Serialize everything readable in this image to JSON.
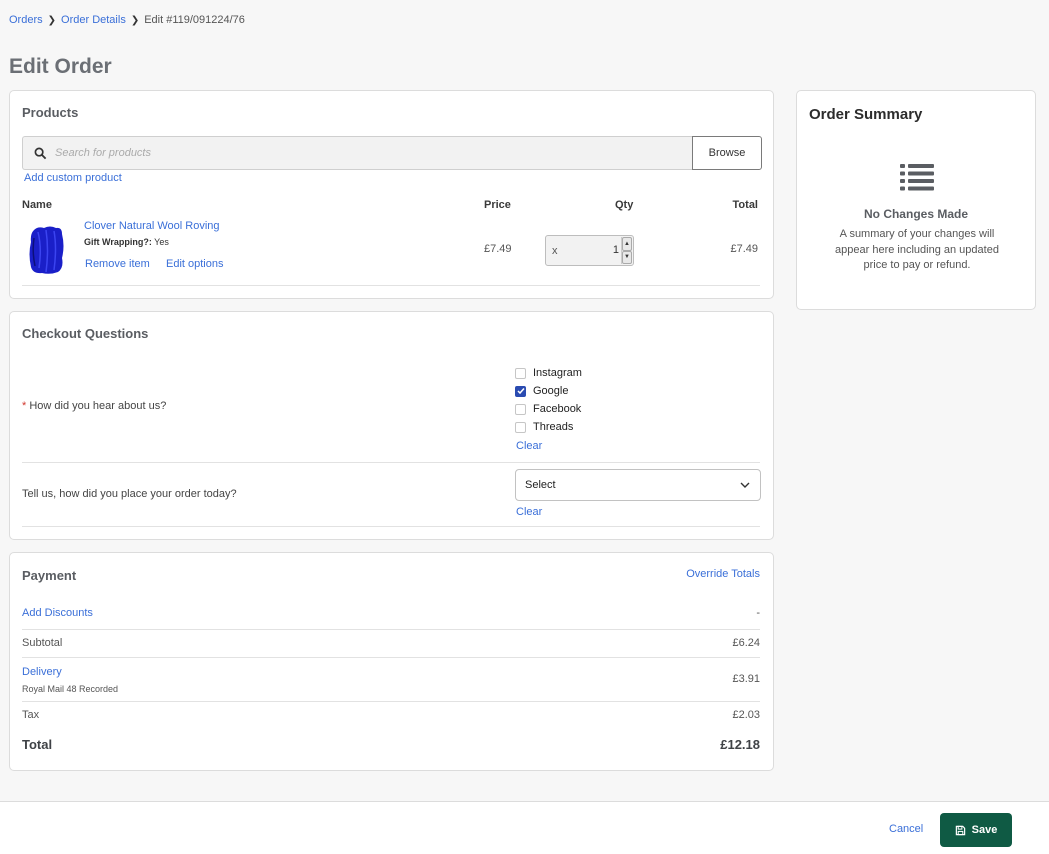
{
  "breadcrumb": {
    "orders": "Orders",
    "order_details": "Order Details",
    "current": "Edit #119/091224/76"
  },
  "page_title": "Edit Order",
  "products": {
    "title": "Products",
    "search_placeholder": "Search for products",
    "browse_label": "Browse",
    "add_custom_label": "Add custom product",
    "columns": {
      "name": "Name",
      "price": "Price",
      "qty": "Qty",
      "total": "Total"
    },
    "items": [
      {
        "name": "Clover Natural Wool Roving",
        "option_label": "Gift Wrapping?:",
        "option_value": "Yes",
        "remove_label": "Remove item",
        "edit_label": "Edit options",
        "price": "£7.49",
        "qty_prefix": "x",
        "qty": "1",
        "total": "£7.49",
        "image_color": "#1a1fc8"
      }
    ]
  },
  "checkout": {
    "title": "Checkout Questions",
    "q1": {
      "required_mark": "*",
      "label": "How did you hear about us?",
      "options": [
        {
          "label": "Instagram",
          "checked": false
        },
        {
          "label": "Google",
          "checked": true
        },
        {
          "label": "Facebook",
          "checked": false
        },
        {
          "label": "Threads",
          "checked": false
        }
      ],
      "clear_label": "Clear"
    },
    "q2": {
      "label": "Tell us, how did you place your order today?",
      "select_value": "Select",
      "clear_label": "Clear"
    }
  },
  "payment": {
    "title": "Payment",
    "override_label": "Override Totals",
    "discounts_label": "Add Discounts",
    "discounts_value": "-",
    "subtotal_label": "Subtotal",
    "subtotal_value": "£6.24",
    "delivery_label": "Delivery",
    "delivery_method": "Royal Mail 48 Recorded",
    "delivery_value": "£3.91",
    "tax_label": "Tax",
    "tax_value": "£2.03",
    "total_label": "Total",
    "total_value": "£12.18"
  },
  "summary": {
    "title": "Order Summary",
    "icon": "list-icon",
    "heading": "No Changes Made",
    "description": "A summary of your changes will appear here including an updated price to pay or refund."
  },
  "footer": {
    "cancel_label": "Cancel",
    "save_label": "Save",
    "save_color": "#0f5a44"
  },
  "colors": {
    "link": "#3a6fd8",
    "checkbox_checked": "#2a4bb1",
    "required": "#d0362c"
  }
}
